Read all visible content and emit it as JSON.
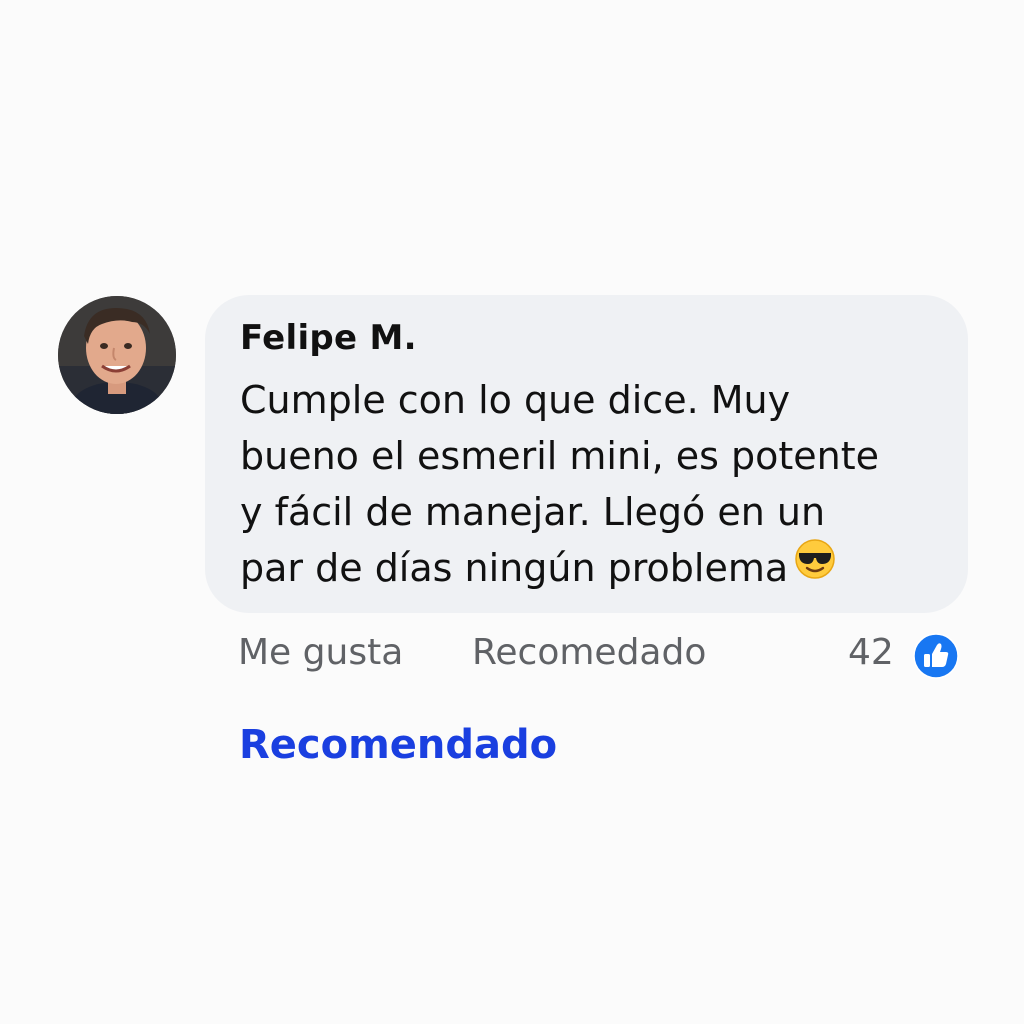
{
  "comment": {
    "author": "Felipe M.",
    "text_lines": [
      "Cumple con lo que dice. Muy",
      "bueno el esmeril mini, es potente",
      "y fácil de manejar. Llegó en un",
      "par de días ningún problema"
    ],
    "emoji": "smiling-face-with-sunglasses-icon"
  },
  "actions": {
    "like_label": "Me gusta",
    "recommend_label": "Recomedado",
    "reaction_count": "42",
    "reaction_icon": "thumbs-up-icon"
  },
  "footer": {
    "recommended_link": "Recomendado"
  },
  "colors": {
    "bubble_bg": "#eff1f4",
    "link_blue": "#1a3fe0",
    "like_badge": "#1877f2",
    "muted_text": "#606266"
  }
}
